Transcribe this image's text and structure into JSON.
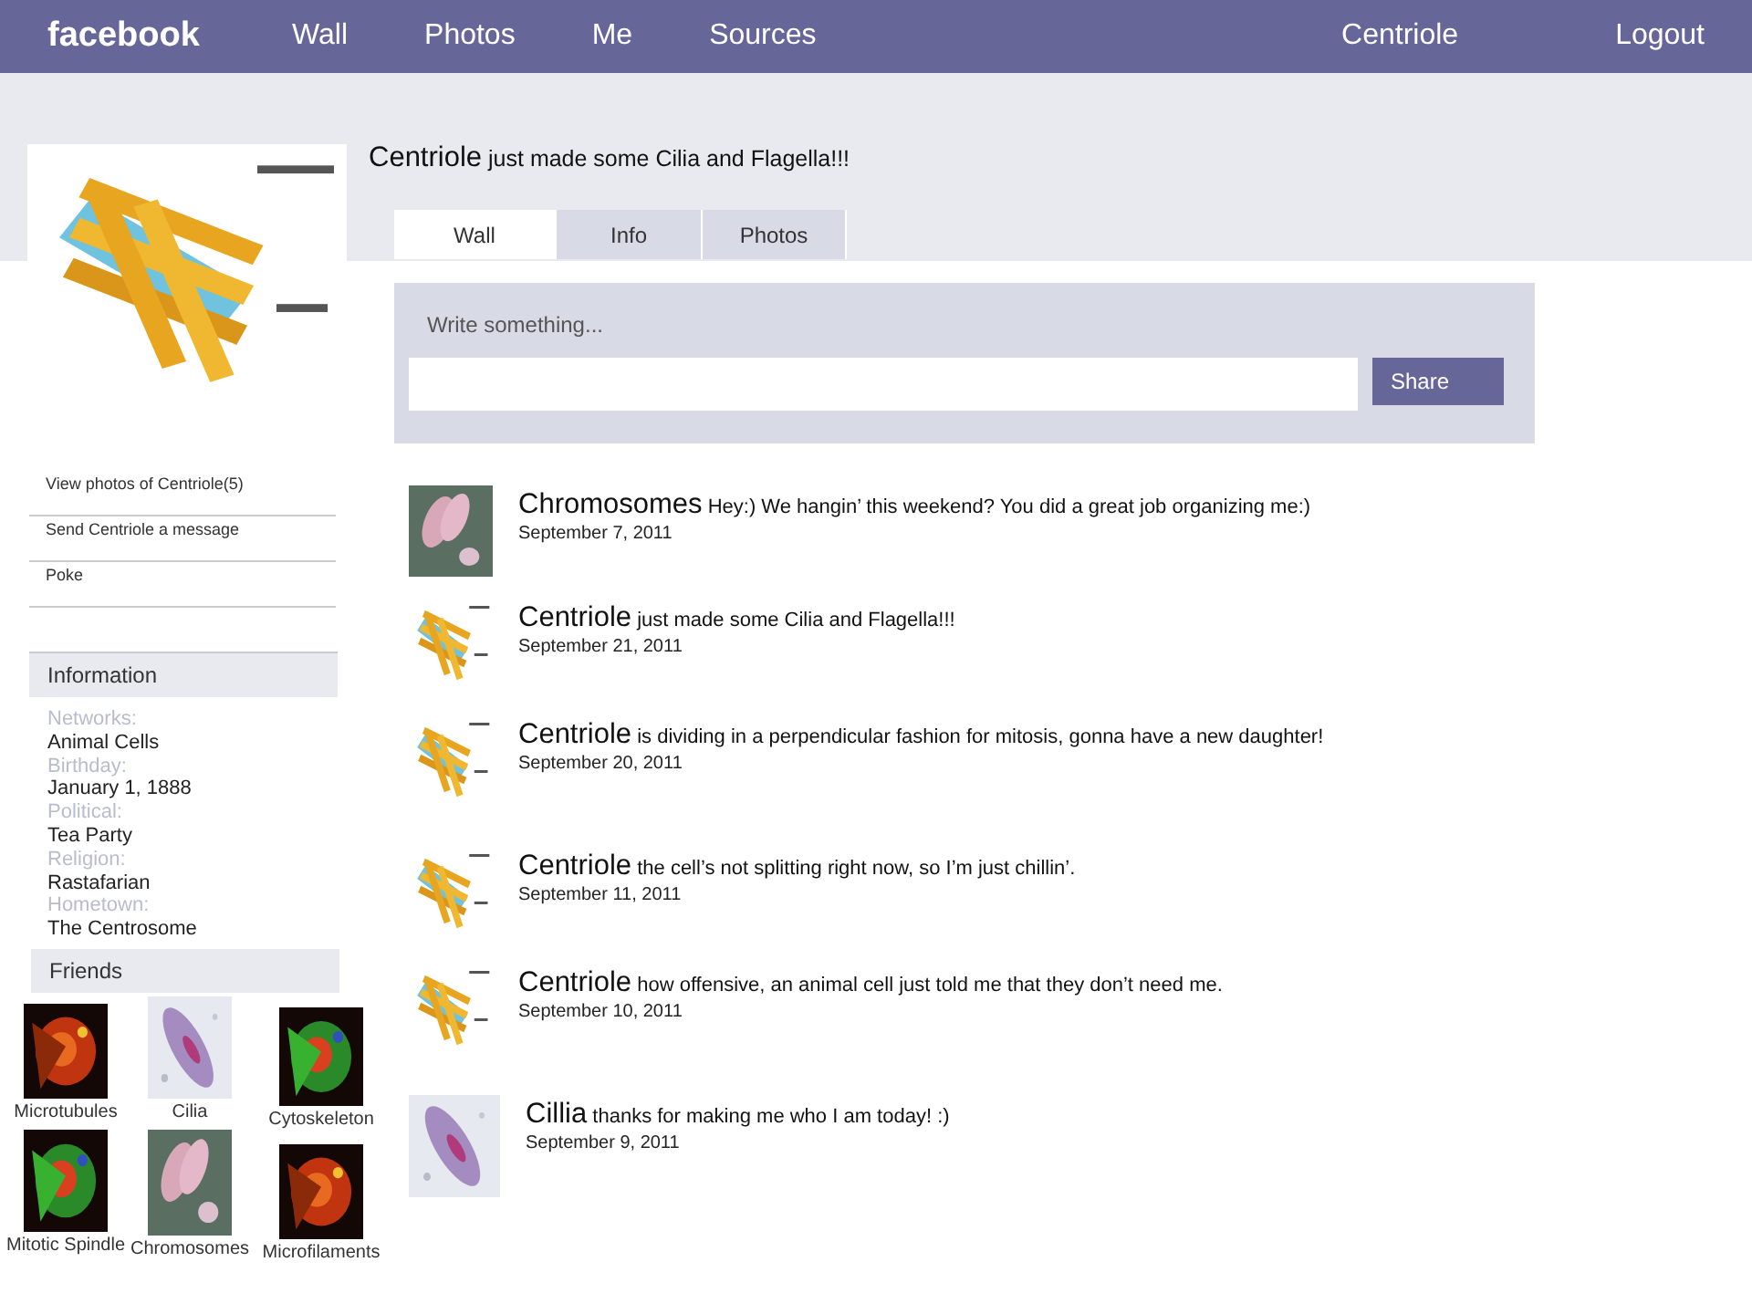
{
  "nav": {
    "logo": "facebook",
    "links": [
      "Wall",
      "Photos",
      "Me",
      "Sources"
    ],
    "user": "Centriole",
    "logout": "Logout"
  },
  "profile": {
    "name": "Centriole",
    "status": "just made some Cilia and Flagella!!!"
  },
  "tabs": [
    {
      "label": "Wall",
      "selected": true
    },
    {
      "label": "Info",
      "selected": false
    },
    {
      "label": "Photos",
      "selected": false
    }
  ],
  "composer": {
    "label": "Write something...",
    "button": "Share"
  },
  "actions": [
    "View photos of Centriole(5)",
    "Send Centriole a message",
    "Poke"
  ],
  "information": {
    "title": "Information",
    "fields": [
      {
        "label": "Networks:",
        "value": "Animal Cells"
      },
      {
        "label": "Birthday:",
        "value": "January 1, 1888"
      },
      {
        "label": "Political:",
        "value": "Tea Party"
      },
      {
        "label": "Religion:",
        "value": "Rastafarian"
      },
      {
        "label": "Hometown:",
        "value": "The Centrosome"
      }
    ]
  },
  "friends": {
    "title": "Friends",
    "items": [
      "Microtubules",
      "Cilia",
      "Cytoskeleton",
      "Mitotic Spindle",
      "Chromosomes",
      "Microfilaments"
    ]
  },
  "posts": [
    {
      "author": "Chromosomes",
      "text": "Hey:) We hangin’ this weekend? You did a great job organizing me:)",
      "date": "September 7, 2011"
    },
    {
      "author": "Centriole",
      "text": "just made some Cilia and Flagella!!!",
      "date": "September 21, 2011"
    },
    {
      "author": "Centriole",
      "text": "is dividing in a perpendicular fashion for mitosis, gonna have a new daughter!",
      "date": "September 20, 2011"
    },
    {
      "author": "Centriole",
      "text": "the cell’s not splitting right now, so I’m just chillin’.",
      "date": "September 11, 2011"
    },
    {
      "author": "Centriole",
      "text": "how offensive, an animal cell just told me that they don’t need me.",
      "date": "September 10, 2011"
    },
    {
      "author": "Cillia",
      "text": "thanks for making me who I am today! :)",
      "date": "September 9, 2011"
    }
  ]
}
